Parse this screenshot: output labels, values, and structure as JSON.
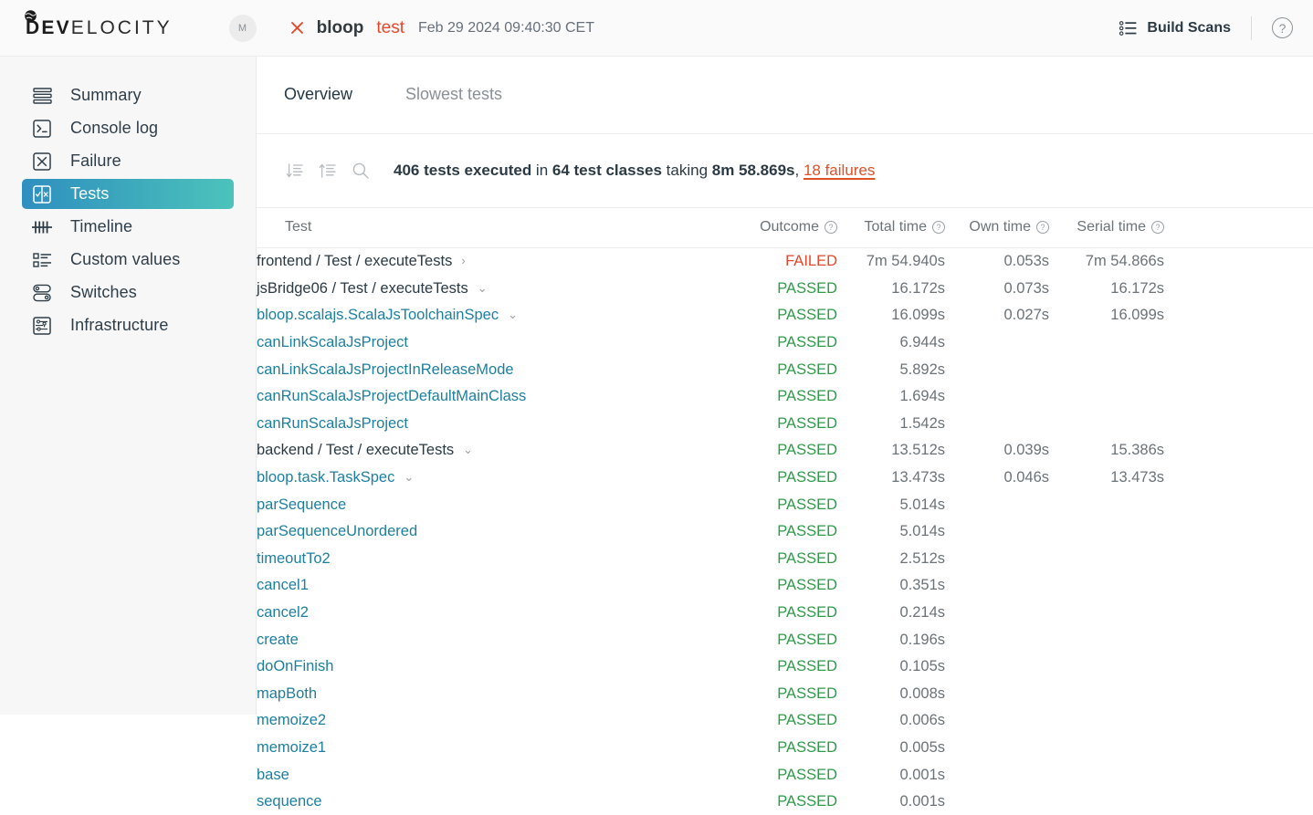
{
  "header": {
    "logo": {
      "bold": "DEV",
      "light": "ELOCITY",
      "mark_icon": "globe-icon"
    },
    "avatar_initial": "M",
    "status_icon": "failure-x-icon",
    "project": "bloop",
    "task": "test",
    "timestamp": "Feb 29 2024 09:40:30 CET",
    "build_scans_label": "Build Scans",
    "build_scans_icon": "list-icon",
    "help_label": "?",
    "help_icon": "help-circle-icon"
  },
  "sidebar": {
    "items": [
      {
        "label": "Summary",
        "icon": "summary-lines-icon",
        "active": false
      },
      {
        "label": "Console log",
        "icon": "terminal-icon",
        "active": false
      },
      {
        "label": "Failure",
        "icon": "x-box-icon",
        "active": false
      },
      {
        "label": "Tests",
        "icon": "tests-split-icon",
        "active": true
      },
      {
        "label": "Timeline",
        "icon": "timeline-icon",
        "active": false
      },
      {
        "label": "Custom values",
        "icon": "custom-values-icon",
        "active": false
      },
      {
        "label": "Switches",
        "icon": "switches-icon",
        "active": false
      },
      {
        "label": "Infrastructure",
        "icon": "infrastructure-icon",
        "active": false
      }
    ]
  },
  "main": {
    "tabs": [
      {
        "label": "Overview",
        "active": true
      },
      {
        "label": "Slowest tests",
        "active": false
      }
    ],
    "toolbar": {
      "sort_desc_icon": "sort-descending-icon",
      "sort_asc_icon": "sort-ascending-icon",
      "search_icon": "search-icon",
      "summary_parts": {
        "count": "406 tests executed",
        "mid1": " in ",
        "classes": "64 test classes",
        "mid2": " taking ",
        "duration": "8m 58.869s",
        "comma": ", ",
        "failures_link": "18 failures"
      }
    },
    "columns": [
      {
        "key": "test",
        "label": "Test",
        "help": false
      },
      {
        "key": "outcome",
        "label": "Outcome",
        "help": true
      },
      {
        "key": "total",
        "label": "Total time",
        "help": true
      },
      {
        "key": "own",
        "label": "Own time",
        "help": true
      },
      {
        "key": "serial",
        "label": "Serial time",
        "help": true
      }
    ],
    "rows": [
      {
        "name": "frontend / Test / executeTests",
        "indent": 0,
        "style": "top",
        "chevron": "right",
        "outcome": "FAILED",
        "outcome_state": "failed",
        "total": "7m 54.940s",
        "own": "0.053s",
        "serial": "7m 54.866s"
      },
      {
        "name": "jsBridge06 / Test / executeTests",
        "indent": 0,
        "style": "top",
        "chevron": "down",
        "outcome": "PASSED",
        "outcome_state": "passed",
        "total": "16.172s",
        "own": "0.073s",
        "serial": "16.172s"
      },
      {
        "name": "bloop.scalajs.ScalaJsToolchainSpec",
        "indent": 1,
        "style": "link",
        "chevron": "down",
        "outcome": "PASSED",
        "outcome_state": "passed",
        "total": "16.099s",
        "own": "0.027s",
        "serial": "16.099s"
      },
      {
        "name": "canLinkScalaJsProject",
        "indent": 2,
        "style": "link",
        "chevron": "none",
        "outcome": "PASSED",
        "outcome_state": "passed",
        "total": "6.944s",
        "own": "",
        "serial": ""
      },
      {
        "name": "canLinkScalaJsProjectInReleaseMode",
        "indent": 2,
        "style": "link",
        "chevron": "none",
        "outcome": "PASSED",
        "outcome_state": "passed",
        "total": "5.892s",
        "own": "",
        "serial": ""
      },
      {
        "name": "canRunScalaJsProjectDefaultMainClass",
        "indent": 2,
        "style": "link",
        "chevron": "none",
        "outcome": "PASSED",
        "outcome_state": "passed",
        "total": "1.694s",
        "own": "",
        "serial": ""
      },
      {
        "name": "canRunScalaJsProject",
        "indent": 2,
        "style": "link",
        "chevron": "none",
        "outcome": "PASSED",
        "outcome_state": "passed",
        "total": "1.542s",
        "own": "",
        "serial": ""
      },
      {
        "name": "backend / Test / executeTests",
        "indent": 0,
        "style": "top",
        "chevron": "down",
        "outcome": "PASSED",
        "outcome_state": "passed",
        "total": "13.512s",
        "own": "0.039s",
        "serial": "15.386s"
      },
      {
        "name": "bloop.task.TaskSpec",
        "indent": 1,
        "style": "link",
        "chevron": "down",
        "outcome": "PASSED",
        "outcome_state": "passed",
        "total": "13.473s",
        "own": "0.046s",
        "serial": "13.473s"
      },
      {
        "name": "parSequence",
        "indent": 2,
        "style": "link",
        "chevron": "none",
        "outcome": "PASSED",
        "outcome_state": "passed",
        "total": "5.014s",
        "own": "",
        "serial": ""
      },
      {
        "name": "parSequenceUnordered",
        "indent": 2,
        "style": "link",
        "chevron": "none",
        "outcome": "PASSED",
        "outcome_state": "passed",
        "total": "5.014s",
        "own": "",
        "serial": ""
      },
      {
        "name": "timeoutTo2",
        "indent": 2,
        "style": "link",
        "chevron": "none",
        "outcome": "PASSED",
        "outcome_state": "passed",
        "total": "2.512s",
        "own": "",
        "serial": ""
      },
      {
        "name": "cancel1",
        "indent": 2,
        "style": "link",
        "chevron": "none",
        "outcome": "PASSED",
        "outcome_state": "passed",
        "total": "0.351s",
        "own": "",
        "serial": ""
      },
      {
        "name": "cancel2",
        "indent": 2,
        "style": "link",
        "chevron": "none",
        "outcome": "PASSED",
        "outcome_state": "passed",
        "total": "0.214s",
        "own": "",
        "serial": ""
      },
      {
        "name": "create",
        "indent": 2,
        "style": "link",
        "chevron": "none",
        "outcome": "PASSED",
        "outcome_state": "passed",
        "total": "0.196s",
        "own": "",
        "serial": ""
      },
      {
        "name": "doOnFinish",
        "indent": 2,
        "style": "link",
        "chevron": "none",
        "outcome": "PASSED",
        "outcome_state": "passed",
        "total": "0.105s",
        "own": "",
        "serial": ""
      },
      {
        "name": "mapBoth",
        "indent": 2,
        "style": "link",
        "chevron": "none",
        "outcome": "PASSED",
        "outcome_state": "passed",
        "total": "0.008s",
        "own": "",
        "serial": ""
      },
      {
        "name": "memoize2",
        "indent": 2,
        "style": "link",
        "chevron": "none",
        "outcome": "PASSED",
        "outcome_state": "passed",
        "total": "0.006s",
        "own": "",
        "serial": ""
      },
      {
        "name": "memoize1",
        "indent": 2,
        "style": "link",
        "chevron": "none",
        "outcome": "PASSED",
        "outcome_state": "passed",
        "total": "0.005s",
        "own": "",
        "serial": ""
      },
      {
        "name": "base",
        "indent": 2,
        "style": "link",
        "chevron": "none",
        "outcome": "PASSED",
        "outcome_state": "passed",
        "total": "0.001s",
        "own": "",
        "serial": ""
      },
      {
        "name": "sequence",
        "indent": 2,
        "style": "link",
        "chevron": "none",
        "outcome": "PASSED",
        "outcome_state": "passed",
        "total": "0.001s",
        "own": "",
        "serial": ""
      }
    ]
  },
  "colors": {
    "passed": "#2e9b49",
    "failed": "#e4472c",
    "link": "#1d7fa0",
    "accent_gradient_start": "#2f8fc0",
    "accent_gradient_end": "#4cc3bb",
    "failures_link": "#de5227"
  }
}
